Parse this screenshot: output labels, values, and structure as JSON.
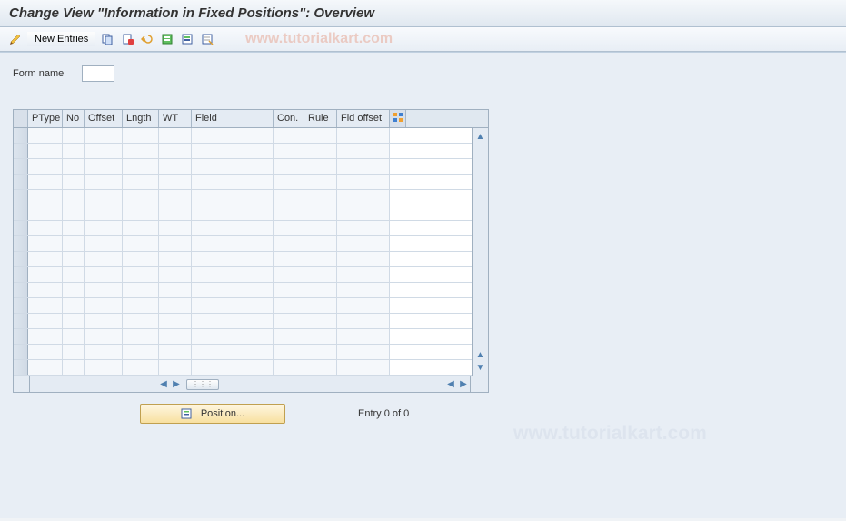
{
  "title": "Change View \"Information in Fixed Positions\": Overview",
  "toolbar": {
    "new_entries_label": "New Entries"
  },
  "watermark": "www.tutorialkart.com",
  "form": {
    "name_label": "Form name",
    "name_value": ""
  },
  "grid": {
    "columns": [
      "PType",
      "No",
      "Offset",
      "Lngth",
      "WT",
      "Field",
      "Con.",
      "Rule",
      "Fld offset"
    ]
  },
  "bottom": {
    "position_label": "Position...",
    "entry_text": "Entry 0 of 0"
  }
}
